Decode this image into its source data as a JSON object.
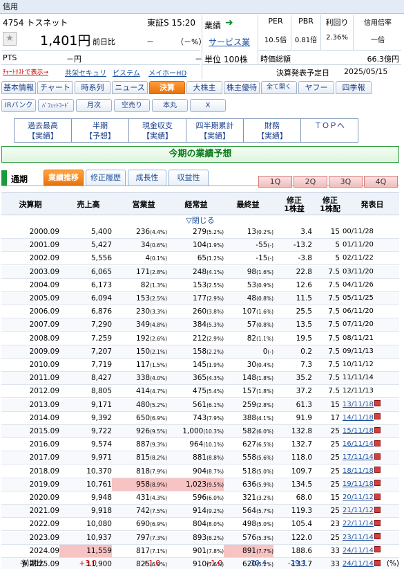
{
  "header": {
    "section_label": "信用",
    "code_name": "4754 トスネット",
    "market_time": "東証S  15:20",
    "price": "1,401円",
    "prev_close_label": "前日比",
    "change": "－",
    "change_pct": "（－%）",
    "pts_label": "PTS",
    "pts_value": "－円",
    "pts_dash": "－",
    "chart_list_link": "ﾁｬｰﾄﾘｽﾄで表示→",
    "related": [
      "共栄セキュリ",
      "ビステム",
      "メイホーHD"
    ],
    "gyoseki_label": "業績",
    "industry": "サービス業",
    "unit": "単位 100株",
    "per_label": "PER",
    "per_value": "10.5倍",
    "pbr_label": "PBR",
    "pbr_value": "0.81倍",
    "yield_label": "利回り",
    "yield_value": "2.36%",
    "margin_label": "信用倍率",
    "margin_value": "一倍",
    "mktcap_label": "時価総額",
    "mktcap_value": "66.3億円",
    "announce_label": "決算発表予定日",
    "announce_date": "2025/05/15"
  },
  "tabs_row1": [
    "基本情報",
    "チャート",
    "時系列",
    "ニュース",
    "決算",
    "大株主",
    "株主優待",
    "全て開く",
    "ヤフー",
    "四季報"
  ],
  "tabs_row1_active": "決算",
  "tabs_row2": [
    "IRバンク",
    "ﾊﾞﾌｪｯﾄｺｰﾄﾞ",
    "月次",
    "空売り",
    "本丸",
    "X"
  ],
  "nav_boxes": [
    [
      "過去最高",
      "【実績】"
    ],
    [
      "半期",
      "【予想】"
    ],
    [
      "現金収支",
      "【実績】"
    ],
    [
      "四半期累計",
      "【実績】"
    ],
    [
      "財務",
      "【実績】"
    ],
    [
      "ＴＯＰへ",
      ""
    ]
  ],
  "banner": "今期の業績予想",
  "subtabs": {
    "period": "通期",
    "items": [
      "業績推移",
      "修正履歴",
      "成長性",
      "収益性"
    ],
    "active": "業績推移",
    "quarters": [
      "1Q",
      "2Q",
      "3Q",
      "4Q"
    ]
  },
  "table": {
    "headers": [
      "決算期",
      "売上高",
      "営業益",
      "経常益",
      "最終益",
      "修正\n1株益",
      "修正\n1株配",
      "発表日"
    ],
    "collapse_label": "▽閉じる",
    "rows": [
      [
        "2000.09",
        "5,400",
        "236",
        "4.4",
        "279",
        "5.2",
        "13",
        "0.2",
        "3.4",
        "15",
        "00/11/28",
        false
      ],
      [
        "2001.09",
        "5,427",
        "34",
        "0.6",
        "104",
        "1.9",
        "-55",
        "-",
        "-13.2",
        "5",
        "01/11/20",
        false
      ],
      [
        "2002.09",
        "5,556",
        "4",
        "0.1",
        "65",
        "1.2",
        "-15",
        "-",
        "-3.8",
        "5",
        "02/11/22",
        false
      ],
      [
        "2003.09",
        "6,065",
        "171",
        "2.8",
        "248",
        "4.1",
        "98",
        "1.6",
        "22.8",
        "7.5",
        "03/11/20",
        false
      ],
      [
        "2004.09",
        "6,173",
        "82",
        "1.3",
        "153",
        "2.5",
        "53",
        "0.9",
        "12.6",
        "7.5",
        "04/11/26",
        false
      ],
      [
        "2005.09",
        "6,094",
        "153",
        "2.5",
        "177",
        "2.9",
        "48",
        "0.8",
        "11.5",
        "7.5",
        "05/11/25",
        false
      ],
      [
        "2006.09",
        "6,876",
        "230",
        "3.3",
        "260",
        "3.8",
        "107",
        "1.6",
        "25.5",
        "7.5",
        "06/11/20",
        false
      ],
      [
        "2007.09",
        "7,290",
        "349",
        "4.8",
        "384",
        "5.3",
        "57",
        "0.8",
        "13.5",
        "7.5",
        "07/11/20",
        false
      ],
      [
        "2008.09",
        "7,259",
        "192",
        "2.6",
        "212",
        "2.9",
        "82",
        "1.1",
        "19.5",
        "7.5",
        "08/11/21",
        false
      ],
      [
        "2009.09",
        "7,207",
        "150",
        "2.1",
        "158",
        "2.2",
        "0",
        "-",
        "0.2",
        "7.5",
        "09/11/13",
        false
      ],
      [
        "2010.09",
        "7,719",
        "117",
        "1.5",
        "145",
        "1.9",
        "30",
        "0.4",
        "7.3",
        "7.5",
        "10/11/12",
        false
      ],
      [
        "2011.09",
        "8,427",
        "338",
        "4.0",
        "365",
        "4.3",
        "148",
        "1.8",
        "35.2",
        "7.5",
        "11/11/14",
        false
      ],
      [
        "2012.09",
        "8,805",
        "414",
        "4.7",
        "475",
        "5.4",
        "157",
        "1.8",
        "37.2",
        "7.5",
        "12/11/13",
        false
      ],
      [
        "2013.09",
        "9,171",
        "480",
        "5.2",
        "561",
        "6.1",
        "259",
        "2.8",
        "61.3",
        "15",
        "13/11/18",
        true
      ],
      [
        "2014.09",
        "9,392",
        "650",
        "6.9",
        "743",
        "7.9",
        "388",
        "4.1",
        "91.9",
        "17",
        "14/11/18",
        true
      ],
      [
        "2015.09",
        "9,722",
        "926",
        "9.5",
        "1,000",
        "10.3",
        "582",
        "6.0",
        "132.8",
        "25",
        "15/11/18",
        true
      ],
      [
        "2016.09",
        "9,574",
        "887",
        "9.3",
        "964",
        "10.1",
        "627",
        "6.5",
        "132.7",
        "25",
        "16/11/14",
        true
      ],
      [
        "2017.09",
        "9,971",
        "815",
        "8.2",
        "881",
        "8.8",
        "558",
        "5.6",
        "118.0",
        "25",
        "17/11/14",
        true
      ],
      [
        "2018.09",
        "10,370",
        "818",
        "7.9",
        "904",
        "8.7",
        "518",
        "5.0",
        "109.7",
        "25",
        "18/11/18",
        true
      ],
      [
        "2019.09",
        "10,761",
        "958",
        "8.9",
        "1,023",
        "9.5",
        "636",
        "5.9",
        "134.5",
        "25",
        "19/11/18",
        true
      ],
      [
        "2020.09",
        "9,948",
        "431",
        "4.3",
        "596",
        "6.0",
        "321",
        "3.2",
        "68.0",
        "15",
        "20/11/12",
        true
      ],
      [
        "2021.09",
        "9,918",
        "742",
        "7.5",
        "914",
        "9.2",
        "564",
        "5.7",
        "119.3",
        "25",
        "21/11/12",
        true
      ],
      [
        "2022.09",
        "10,080",
        "690",
        "6.9",
        "804",
        "8.0",
        "498",
        "5.0",
        "105.4",
        "23",
        "22/11/14",
        true
      ],
      [
        "2023.09",
        "10,937",
        "797",
        "7.3",
        "893",
        "8.2",
        "576",
        "5.3",
        "122.0",
        "25",
        "23/11/14",
        true
      ],
      [
        "2024.09",
        "11,559",
        "817",
        "7.1",
        "901",
        "7.8",
        "891",
        "7.7",
        "188.6",
        "33",
        "24/11/14",
        true
      ],
      [
        "予 2025.09",
        "11,900",
        "825",
        "6.9",
        "910",
        "7.6",
        "620",
        "5.2",
        "133.7",
        "33",
        "24/11/14",
        true
      ]
    ],
    "highlights": {
      "2019.09": [
        "op",
        "ord"
      ],
      "2024.09": [
        "sales",
        "net"
      ]
    },
    "prev_compare": {
      "label": "前期比",
      "sales": "+3.0",
      "op": "+1.0",
      "ord": "+1.0",
      "net": "-30.4",
      "eps": "-29.1",
      "unit": "(%)"
    }
  },
  "colors": {
    "accent_orange": "#e8700a",
    "link_blue": "#1a4fa0",
    "banner_green": "#0a7a1a",
    "highlight_pink": "#f7c3c3",
    "positive_red": "#c00000"
  }
}
